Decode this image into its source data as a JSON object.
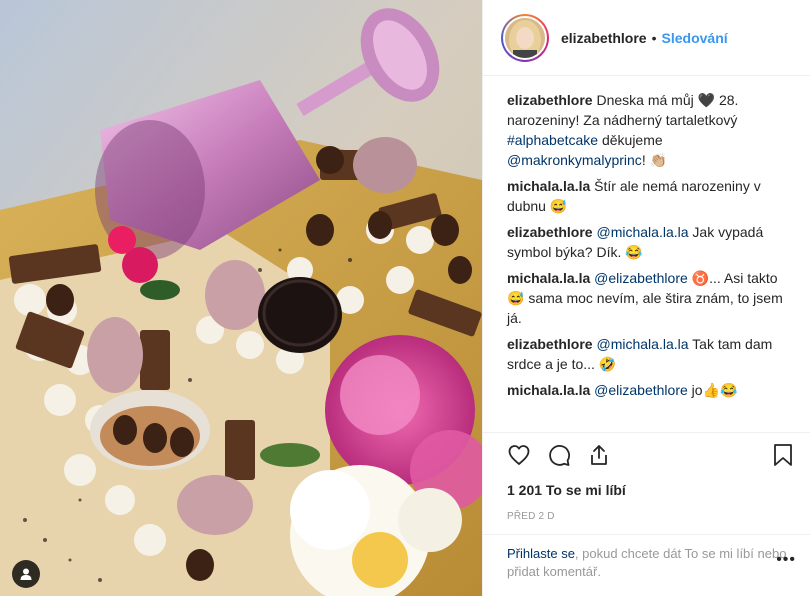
{
  "post": {
    "username": "elizabethlore",
    "separator": "•",
    "follow_label": "Sledování"
  },
  "comments": [
    {
      "user": "elizabethlore",
      "segments": [
        {
          "t": "Dneska má můj 🖤 28. narozeniny! Za nádherný tartaletkový ",
          "link": false
        },
        {
          "t": "#alphabetcake",
          "link": true
        },
        {
          "t": " děkujeme ",
          "link": false
        },
        {
          "t": "@makronkymalyprinc",
          "link": true
        },
        {
          "t": "! 👏🏼",
          "link": false
        }
      ]
    },
    {
      "user": "michala.la.la",
      "segments": [
        {
          "t": "Štír ale nemá narozeniny v dubnu 😅",
          "link": false
        }
      ]
    },
    {
      "user": "elizabethlore",
      "segments": [
        {
          "t": "@michala.la.la",
          "link": true
        },
        {
          "t": " Jak vypadá symbol býka? Dík. 😂",
          "link": false
        }
      ]
    },
    {
      "user": "michala.la.la",
      "segments": [
        {
          "t": "@elizabethlore",
          "link": true
        },
        {
          "t": " ♉... Asi takto 😅 sama moc nevím, ale štira znám, to jsem já.",
          "link": false
        }
      ]
    },
    {
      "user": "elizabethlore",
      "segments": [
        {
          "t": "@michala.la.la",
          "link": true
        },
        {
          "t": " Tak tam dam srdce a je to... 🤣",
          "link": false
        }
      ]
    },
    {
      "user": "michala.la.la",
      "segments": [
        {
          "t": "@elizabethlore",
          "link": true
        },
        {
          "t": " jo👍😂",
          "link": false
        }
      ]
    }
  ],
  "actions": {
    "like_icon": "heart-icon",
    "comment_icon": "comment-icon",
    "share_icon": "share-icon",
    "save_icon": "bookmark-icon"
  },
  "likes_text": "1 201 To se mi líbí",
  "date_text": "PŘED 2 D",
  "login": {
    "link_text": "Přihlaste se",
    "rest_text": ", pokud chcete dát To se mi líbí nebo přidat komentář.",
    "more_label": "•••"
  },
  "colors": {
    "accent": "#3897f0",
    "link": "#003569",
    "muted": "#999999",
    "border": "#efefef"
  }
}
